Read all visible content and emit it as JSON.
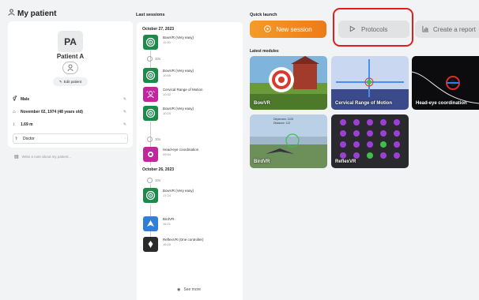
{
  "patient_panel": {
    "title": "My patient",
    "initials": "PA",
    "name": "Patient A",
    "edit_label": "Edit patient",
    "sex": "Male",
    "birthdate": "November 02, 1974 (48 years old)",
    "height": "1.69 m",
    "doctor_placeholder": "Doctor",
    "note_placeholder": "Write a note about my patient..."
  },
  "last_sessions": {
    "title": "Last sessions",
    "see_more": "See more",
    "days": [
      {
        "date": "October 27, 2023",
        "entries": [
          {
            "name": "BowVR (Very easy)",
            "time": "11:00",
            "icon": "target-icon"
          },
          {
            "duration": "30s"
          },
          {
            "name": "BowVR (Very easy)",
            "time": "10:59",
            "icon": "target-icon"
          },
          {
            "name": "Cervical Range of Motion",
            "time": "10:32",
            "icon": "cervical-icon"
          },
          {
            "name": "BowVR (Very easy)",
            "time": "10:24",
            "icon": "target-icon"
          },
          {
            "duration": "30s"
          },
          {
            "name": "Head-eye coordination",
            "time": "09:54",
            "icon": "head-eye-icon"
          }
        ]
      },
      {
        "date": "October 26, 2023",
        "entries": [
          {
            "duration": "30s"
          },
          {
            "name": "BowVR (Very easy)",
            "time": "17:24",
            "icon": "target-icon"
          },
          {
            "name": "BirdVR",
            "time": "16:21",
            "icon": "bird-icon"
          },
          {
            "name": "ReflexVR (One controller)",
            "time": "16:20",
            "icon": "reflex-icon"
          }
        ]
      }
    ]
  },
  "quick_launch": {
    "title": "Quick launch",
    "new_session": "New session",
    "protocols": "Protocols",
    "create_report": "Create a report"
  },
  "latest_modules": {
    "title": "Latest modules",
    "items": [
      "BowVR",
      "Cervical Range of Motion",
      "Head-eye coordination",
      "BirdVR",
      "ReflexVR"
    ],
    "birdvr_hud": [
      "Dépenses: 1100",
      "Distance: 112"
    ]
  },
  "colors": {
    "accent_orange": "#f08a1f",
    "highlight_red": "#e01e1e",
    "bowvr_green": "#1d8a4a",
    "cervical_magenta": "#c2269f",
    "bird_blue": "#2f7fd6"
  }
}
